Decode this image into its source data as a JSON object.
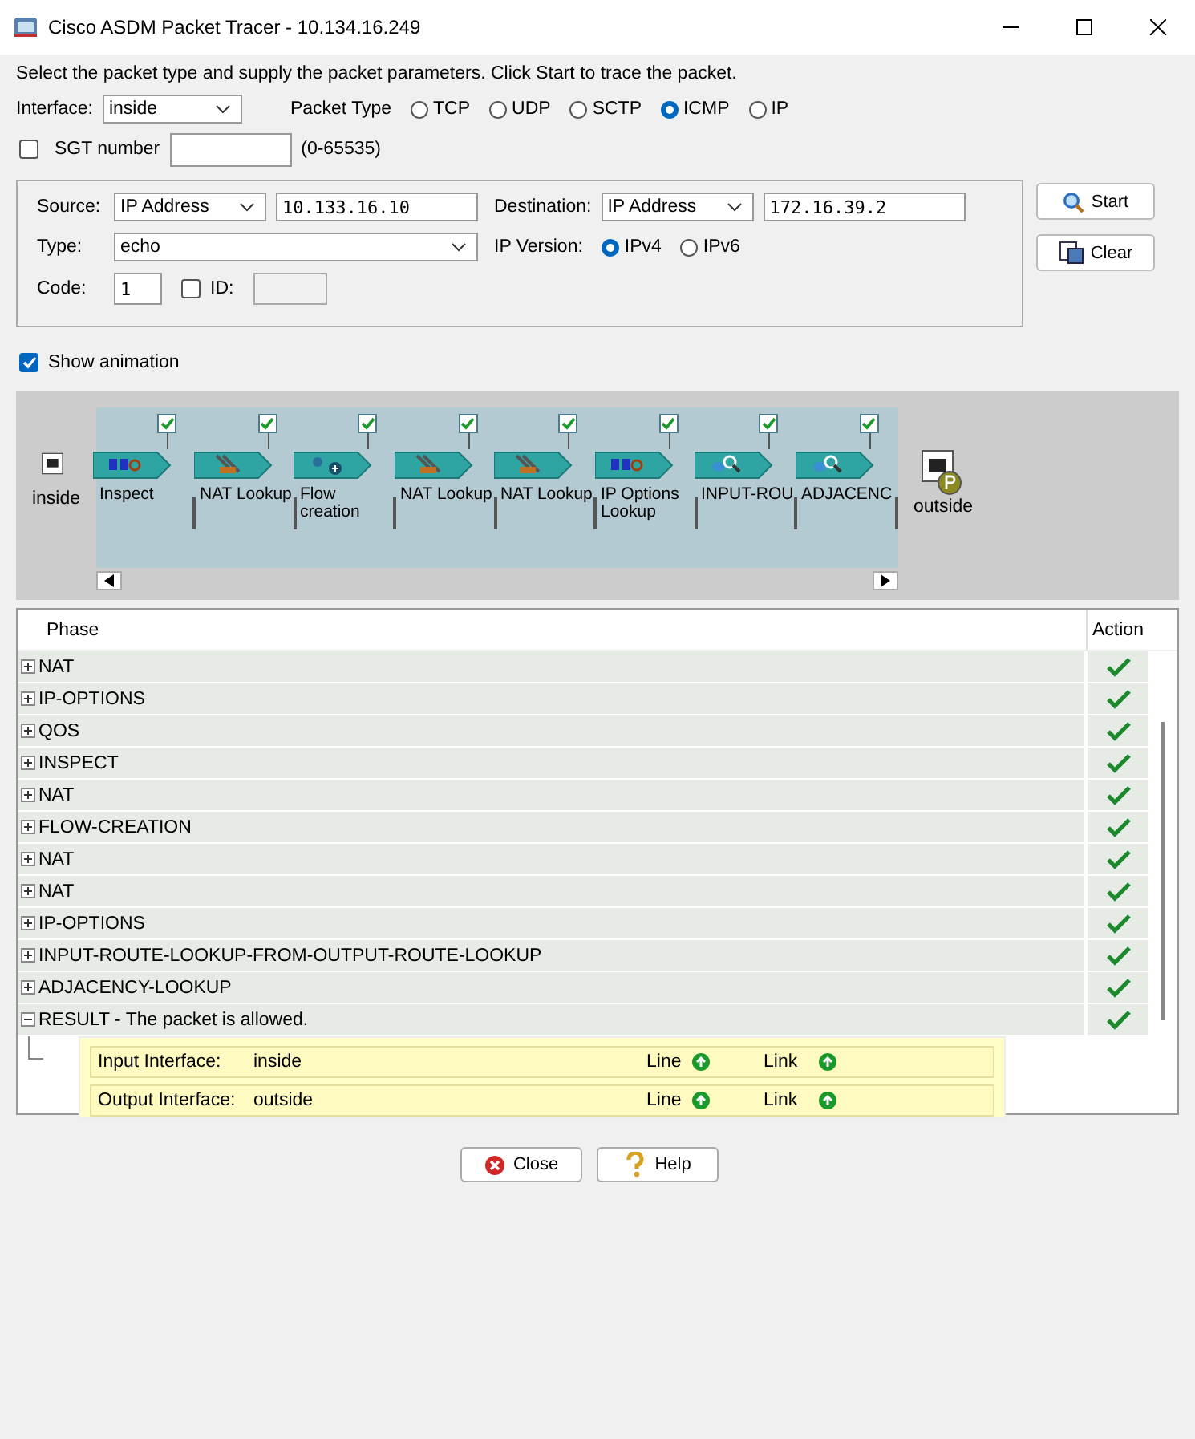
{
  "window": {
    "title": "Cisco ASDM Packet Tracer - 10.134.16.249"
  },
  "instruction": "Select the packet type and supply the packet parameters. Click Start to trace the packet.",
  "interface": {
    "label": "Interface:",
    "value": "inside"
  },
  "packet_type": {
    "label": "Packet Type",
    "options": [
      {
        "label": "TCP",
        "selected": false
      },
      {
        "label": "UDP",
        "selected": false
      },
      {
        "label": "SCTP",
        "selected": false
      },
      {
        "label": "ICMP",
        "selected": true
      },
      {
        "label": "IP",
        "selected": false
      }
    ]
  },
  "sgt": {
    "label": "SGT number",
    "checked": false,
    "range": "(0-65535)"
  },
  "source": {
    "label": "Source:",
    "type": "IP Address",
    "value": "10.133.16.10"
  },
  "destination": {
    "label": "Destination:",
    "type": "IP Address",
    "value": "172.16.39.2"
  },
  "icmp_type": {
    "label": "Type:",
    "value": "echo"
  },
  "ip_version": {
    "label": "IP Version:",
    "options": [
      {
        "label": "IPv4",
        "selected": true
      },
      {
        "label": "IPv6",
        "selected": false
      }
    ]
  },
  "code": {
    "label": "Code:",
    "value": "1"
  },
  "id": {
    "label": "ID:",
    "checked": false
  },
  "side_buttons": [
    {
      "label": "Start",
      "kind": "start"
    },
    {
      "label": "Clear",
      "kind": "clear"
    }
  ],
  "show_animation": {
    "label": "Show animation",
    "checked": true
  },
  "pipeline": {
    "start": "inside",
    "end": "outside",
    "stages": [
      {
        "label": "Inspect",
        "kind": "inspect",
        "checked": true
      },
      {
        "label": "NAT Lookup",
        "kind": "nat",
        "checked": true
      },
      {
        "label": "Flow creation",
        "kind": "flow",
        "checked": true
      },
      {
        "label": "NAT Lookup",
        "kind": "nat",
        "checked": true
      },
      {
        "label": "NAT Lookup",
        "kind": "nat",
        "checked": true
      },
      {
        "label": "IP Options Lookup",
        "kind": "inspect",
        "checked": true
      },
      {
        "label": "INPUT-ROU",
        "kind": "route",
        "checked": true
      },
      {
        "label": "ADJACENC",
        "kind": "route",
        "checked": true
      }
    ]
  },
  "table": {
    "columns": [
      "Phase",
      "Action"
    ],
    "rows": [
      {
        "label": "NAT",
        "expanded": false,
        "allowed": true
      },
      {
        "label": "IP-OPTIONS",
        "expanded": false,
        "allowed": true
      },
      {
        "label": "QOS",
        "expanded": false,
        "allowed": true
      },
      {
        "label": "INSPECT",
        "expanded": false,
        "allowed": true
      },
      {
        "label": "NAT",
        "expanded": false,
        "allowed": true
      },
      {
        "label": "FLOW-CREATION",
        "expanded": false,
        "allowed": true
      },
      {
        "label": "NAT",
        "expanded": false,
        "allowed": true
      },
      {
        "label": "NAT",
        "expanded": false,
        "allowed": true
      },
      {
        "label": "IP-OPTIONS",
        "expanded": false,
        "allowed": true
      },
      {
        "label": "INPUT-ROUTE-LOOKUP-FROM-OUTPUT-ROUTE-LOOKUP",
        "expanded": false,
        "allowed": true
      },
      {
        "label": "ADJACENCY-LOOKUP",
        "expanded": false,
        "allowed": true
      },
      {
        "label": "RESULT - The packet is allowed.",
        "expanded": true,
        "allowed": true
      }
    ],
    "result_details": [
      {
        "label": "Input Interface:",
        "value": "inside",
        "line_label": "Line",
        "line_up": true,
        "link_label": "Link",
        "link_up": true
      },
      {
        "label": "Output Interface:",
        "value": "outside",
        "line_label": "Line",
        "line_up": true,
        "link_label": "Link",
        "link_up": true
      }
    ]
  },
  "footer_buttons": [
    {
      "label": "Close",
      "kind": "close"
    },
    {
      "label": "Help",
      "kind": "help"
    }
  ]
}
